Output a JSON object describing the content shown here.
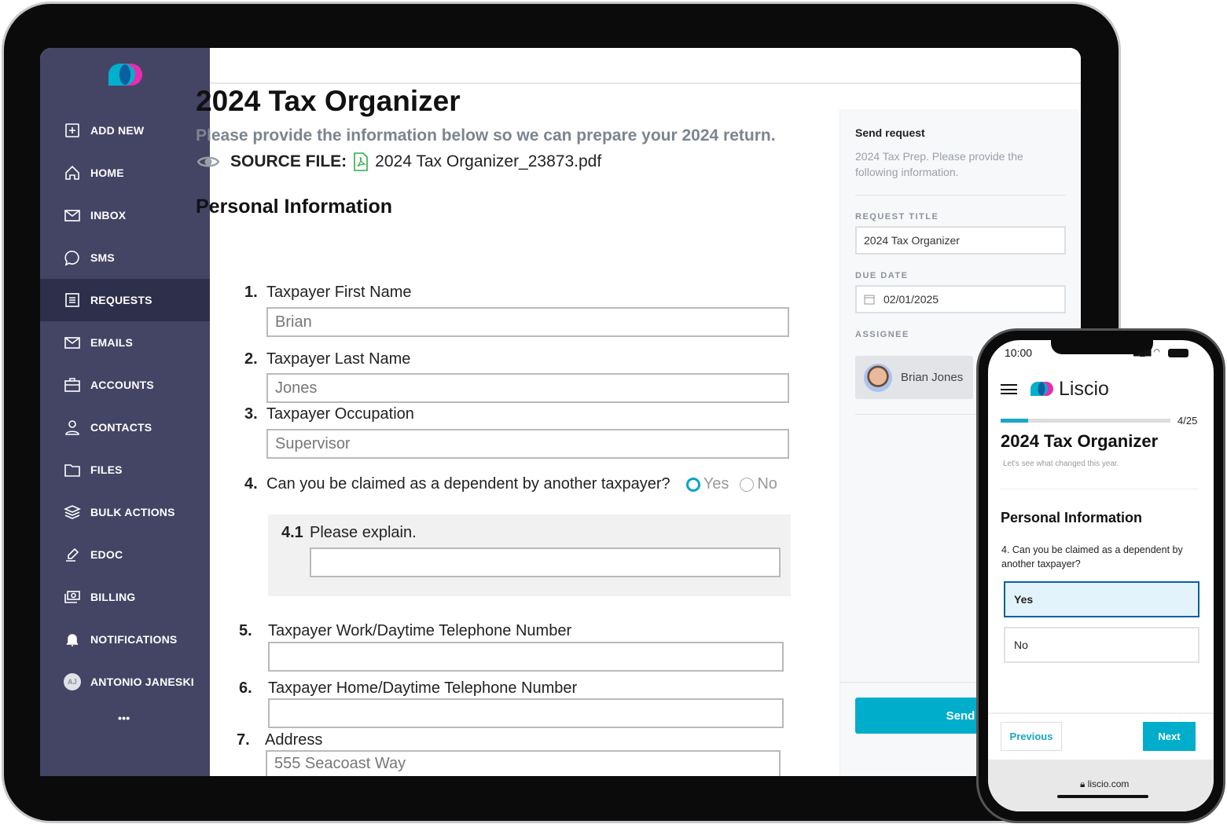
{
  "sidebar": {
    "items": [
      {
        "label": "ADD NEW",
        "icon": "plus-square-icon"
      },
      {
        "label": "HOME",
        "icon": "home-icon"
      },
      {
        "label": "INBOX",
        "icon": "mail-icon"
      },
      {
        "label": "SMS",
        "icon": "chat-icon"
      },
      {
        "label": "REQUESTS",
        "icon": "list-icon",
        "active": true
      },
      {
        "label": "EMAILS",
        "icon": "mail-icon"
      },
      {
        "label": "ACCOUNTS",
        "icon": "briefcase-icon"
      },
      {
        "label": "CONTACTS",
        "icon": "person-icon"
      },
      {
        "label": "FILES",
        "icon": "folder-icon"
      },
      {
        "label": "BULK ACTIONS",
        "icon": "layers-icon"
      },
      {
        "label": "EDOC",
        "icon": "signature-icon"
      },
      {
        "label": "BILLING",
        "icon": "money-icon"
      },
      {
        "label": "NOTIFICATIONS",
        "icon": "bell-icon"
      }
    ],
    "user": {
      "initials": "AJ",
      "name": "ANTONIO JANESKI"
    },
    "more": "•••"
  },
  "form": {
    "title": "2024 Tax Organizer",
    "subtitle": "Please provide the information below so we can prepare your 2024 return.",
    "source_label": "SOURCE FILE:",
    "source_file": "2024 Tax Organizer_23873.pdf",
    "section": "Personal Information",
    "questions": [
      {
        "num": "1.",
        "label": "Taxpayer First Name",
        "value": "Brian"
      },
      {
        "num": "2.",
        "label": "Taxpayer Last Name",
        "value": "Jones"
      },
      {
        "num": "3.",
        "label": "Taxpayer Occupation",
        "value": "Supervisor"
      },
      {
        "num": "4.",
        "label": "Can you be claimed as a dependent by another taxpayer?",
        "options": [
          "Yes",
          "No"
        ],
        "selected": "Yes"
      },
      {
        "num": "4.1",
        "label": "Please explain.",
        "value": ""
      },
      {
        "num": "5.",
        "label": "Taxpayer Work/Daytime Telephone Number",
        "value": ""
      },
      {
        "num": "6.",
        "label": "Taxpayer Home/Daytime Telephone Number",
        "value": ""
      },
      {
        "num": "7.",
        "label": "Address",
        "value": "555 Seacoast Way"
      }
    ]
  },
  "panel": {
    "title": "Send request",
    "description": "2024 Tax Prep. Please provide the following information.",
    "request_title_label": "REQUEST TITLE",
    "request_title": "2024 Tax Organizer",
    "due_date_label": "DUE DATE",
    "due_date": "02/01/2025",
    "assignee_label": "ASSIGNEE",
    "assignee": "Brian Jones",
    "send": "Send"
  },
  "phone": {
    "time": "10:00",
    "brand": "Liscio",
    "progress": "4/25",
    "progress_fraction": 0.16,
    "title": "2024 Tax Organizer",
    "subtitle": "Let's see what changed this year.",
    "section": "Personal Information",
    "question": "4.  Can you be claimed as a dependent by another taxpayer?",
    "options": [
      "Yes",
      "No"
    ],
    "selected": "Yes",
    "previous": "Previous",
    "next": "Next",
    "url": "liscio.com"
  },
  "colors": {
    "sidebar": "#444565",
    "accent": "#00aecb",
    "logo_cyan": "#00b0cc",
    "logo_pink": "#e82bb0"
  }
}
